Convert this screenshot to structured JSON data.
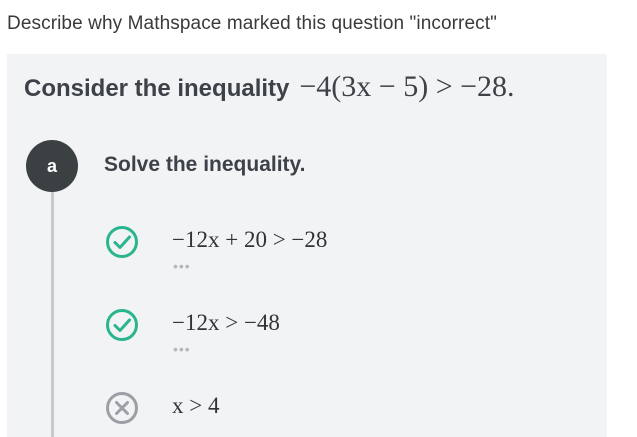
{
  "caption": "Describe why Mathspace marked this question \"incorrect\"",
  "question": {
    "prompt": "Consider the inequality",
    "math": "−4(3x − 5) > −28."
  },
  "part": {
    "label": "a",
    "prompt": "Solve the inequality."
  },
  "steps": [
    {
      "math": "−12x + 20 > −28",
      "status": "correct",
      "icon": "check-circle-icon",
      "more": "•••"
    },
    {
      "math": "−12x > −48",
      "status": "correct",
      "icon": "check-circle-icon",
      "more": "•••"
    },
    {
      "math": "x > 4",
      "status": "incorrect",
      "icon": "x-circle-icon"
    }
  ],
  "colors": {
    "correct": "#2bb58f",
    "incorrect": "#9aa0a5",
    "badge": "#3b4043",
    "panel": "#f2f3f4"
  }
}
